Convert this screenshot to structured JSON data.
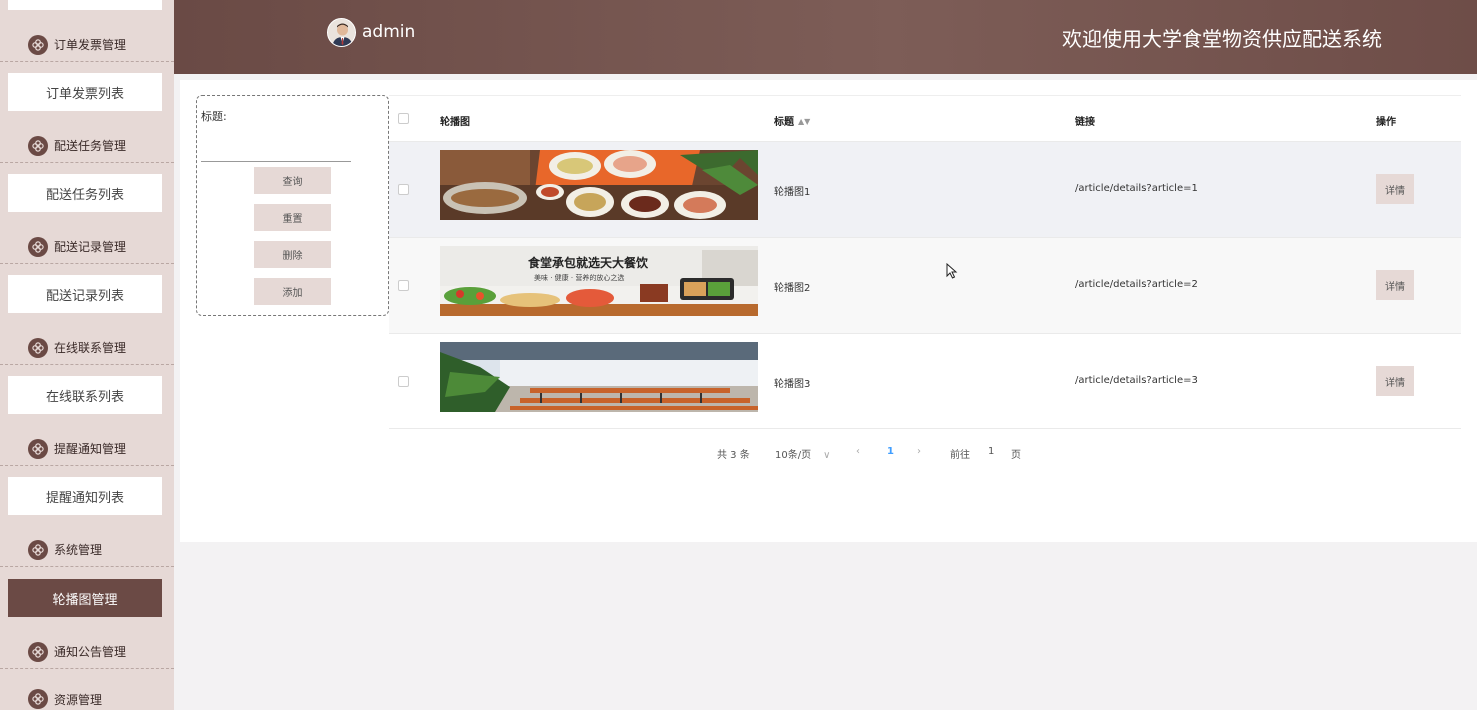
{
  "header": {
    "username": "admin",
    "site_title": "欢迎使用大学食堂物资供应配送系统"
  },
  "sidebar": {
    "groups": [
      {
        "label": "订单发票管理",
        "sub": "订单发票列表"
      },
      {
        "label": "配送任务管理",
        "sub": "配送任务列表"
      },
      {
        "label": "配送记录管理",
        "sub": "配送记录列表"
      },
      {
        "label": "在线联系管理",
        "sub": "在线联系列表"
      },
      {
        "label": "提醒通知管理",
        "sub": "提醒通知列表"
      },
      {
        "label": "系统管理",
        "sub": "轮播图管理"
      },
      {
        "label": "通知公告管理"
      },
      {
        "label": "资源管理"
      }
    ]
  },
  "search": {
    "label": "标题:",
    "value": "",
    "buttons": {
      "query": "查询",
      "reset": "重置",
      "delete": "删除",
      "add": "添加"
    }
  },
  "table": {
    "headers": {
      "image": "轮播图",
      "title": "标题",
      "link": "链接",
      "action": "操作"
    },
    "rows": [
      {
        "title": "轮播图1",
        "link": "/article/details?article=1",
        "action": "详情"
      },
      {
        "title": "轮播图2",
        "link": "/article/details?article=2",
        "action": "详情",
        "banner_text": "食堂承包就选天大餐饮",
        "banner_sub": "美味 · 健康 · 营养的放心之选"
      },
      {
        "title": "轮播图3",
        "link": "/article/details?article=3",
        "action": "详情"
      }
    ]
  },
  "pagination": {
    "total": "共 3 条",
    "page_size": "10条/页",
    "current": "1",
    "goto_label": "前往",
    "goto_value": "1",
    "page_unit": "页"
  },
  "colors": {
    "brand": "#6b4a45",
    "sidebar_bg": "#e6d9d6",
    "link_active": "#409eff"
  }
}
